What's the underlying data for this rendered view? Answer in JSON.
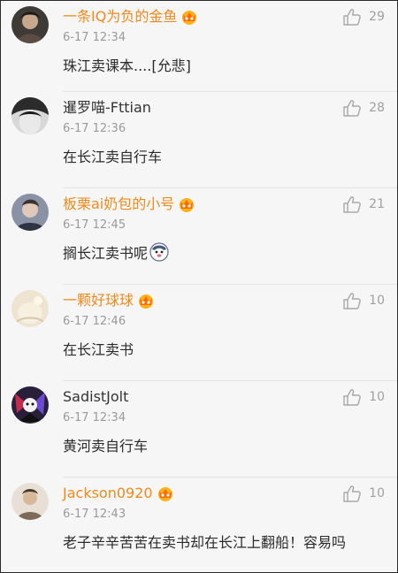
{
  "colors": {
    "background": "#f6f6f6",
    "vip_name": "#f08a1c",
    "normal_name": "#333333",
    "timestamp": "#9a9a9a",
    "like_count": "#a0a0a0"
  },
  "icons": {
    "like": "thumbs-up-icon",
    "vip_badge": "crown-icon",
    "emoji": "doge-emoji-icon"
  },
  "comments": [
    {
      "username": "一条IQ为负的金鱼",
      "vip": true,
      "time": "6-17 12:34",
      "text": "珠江卖课本....[允悲]",
      "likes": "29"
    },
    {
      "username": "暹罗喵-Fttian",
      "vip": false,
      "time": "6-17 12:36",
      "text": "在长江卖自行车",
      "likes": "28"
    },
    {
      "username": "板栗ai奶包的小号",
      "vip": true,
      "time": "6-17 12:45",
      "text": "搁长江卖书呢",
      "likes": "21",
      "emoji": true
    },
    {
      "username": "一颗好球球",
      "vip": true,
      "time": "6-17 12:46",
      "text": "在长江卖书",
      "likes": "10"
    },
    {
      "username": "SadistJolt",
      "vip": false,
      "time": "6-17 12:34",
      "text": "黄河卖自行车",
      "likes": "10"
    },
    {
      "username": "Jackson0920",
      "vip": true,
      "time": "6-17 12:43",
      "text": "老子辛辛苦苦在卖书却在长江上翻船！容易吗",
      "likes": "10"
    }
  ]
}
